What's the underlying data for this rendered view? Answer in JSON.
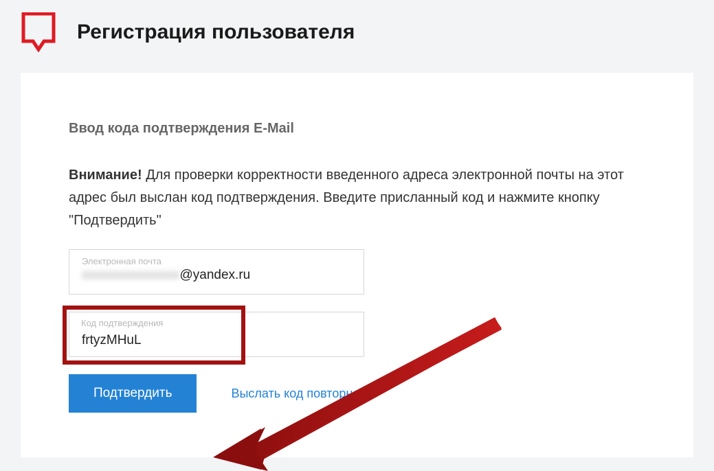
{
  "header": {
    "title": "Регистрация пользователя"
  },
  "section": {
    "heading": "Ввод кода подтверждения E-Mail",
    "attention_label": "Внимание!",
    "instruction_text": " Для проверки корректности введенного адреса электронной почты на этот адрес был выслан код подтверждения. Введите присланный код и нажмите кнопку \"Подтвердить\""
  },
  "email_field": {
    "label": "Электронная почта",
    "value_visible": "@yandex.ru"
  },
  "code_field": {
    "label": "Код подтверждения",
    "value": "frtyzMHuL"
  },
  "actions": {
    "submit_label": "Подтвердить",
    "resend_label": "Выслать код повторно"
  }
}
